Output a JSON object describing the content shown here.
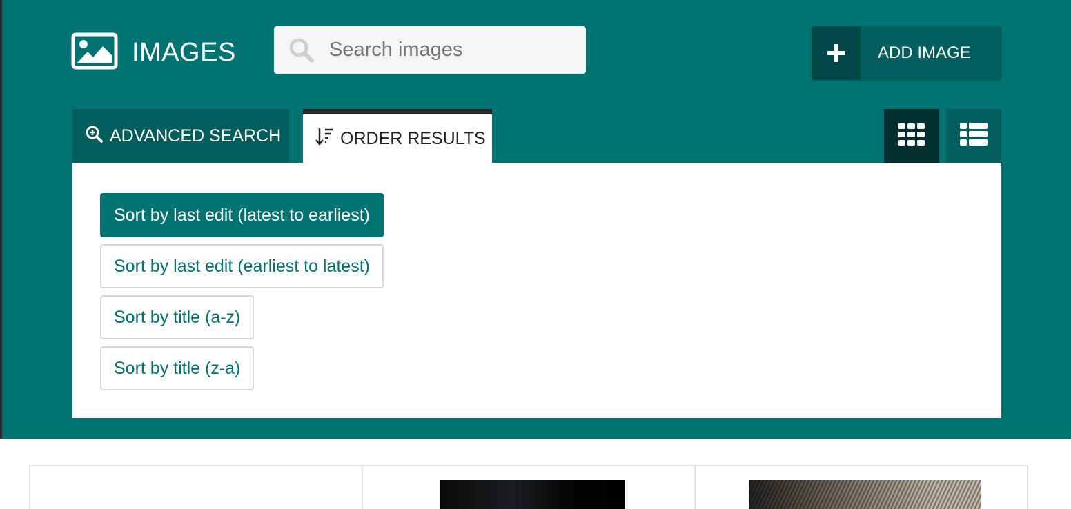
{
  "header": {
    "title": "IMAGES",
    "title_icon": "image-icon",
    "search": {
      "placeholder": "Search images",
      "value": "",
      "icon": "search-icon"
    },
    "add_button": {
      "label": "ADD IMAGE",
      "icon": "plus-icon"
    }
  },
  "tabs": [
    {
      "label": "ADVANCED SEARCH",
      "icon": "zoom-in-icon",
      "active": false
    },
    {
      "label": "ORDER RESULTS",
      "icon": "sort-order-icon",
      "active": true
    }
  ],
  "view_toggles": [
    {
      "name": "grid-view",
      "icon": "grid-icon",
      "active": true
    },
    {
      "name": "list-view",
      "icon": "list-icon",
      "active": false
    }
  ],
  "sort_options": [
    {
      "label": "Sort by last edit (latest to earliest)",
      "active": true
    },
    {
      "label": "Sort by last edit (earliest to latest)",
      "active": false
    },
    {
      "label": "Sort by title (a-z)",
      "active": false
    },
    {
      "label": "Sort by title (z-a)",
      "active": false
    }
  ],
  "colors": {
    "primary": "#017373",
    "primary_dark": "#025d5d",
    "active_view": "#012f2f",
    "tab_top_border": "#262626"
  }
}
